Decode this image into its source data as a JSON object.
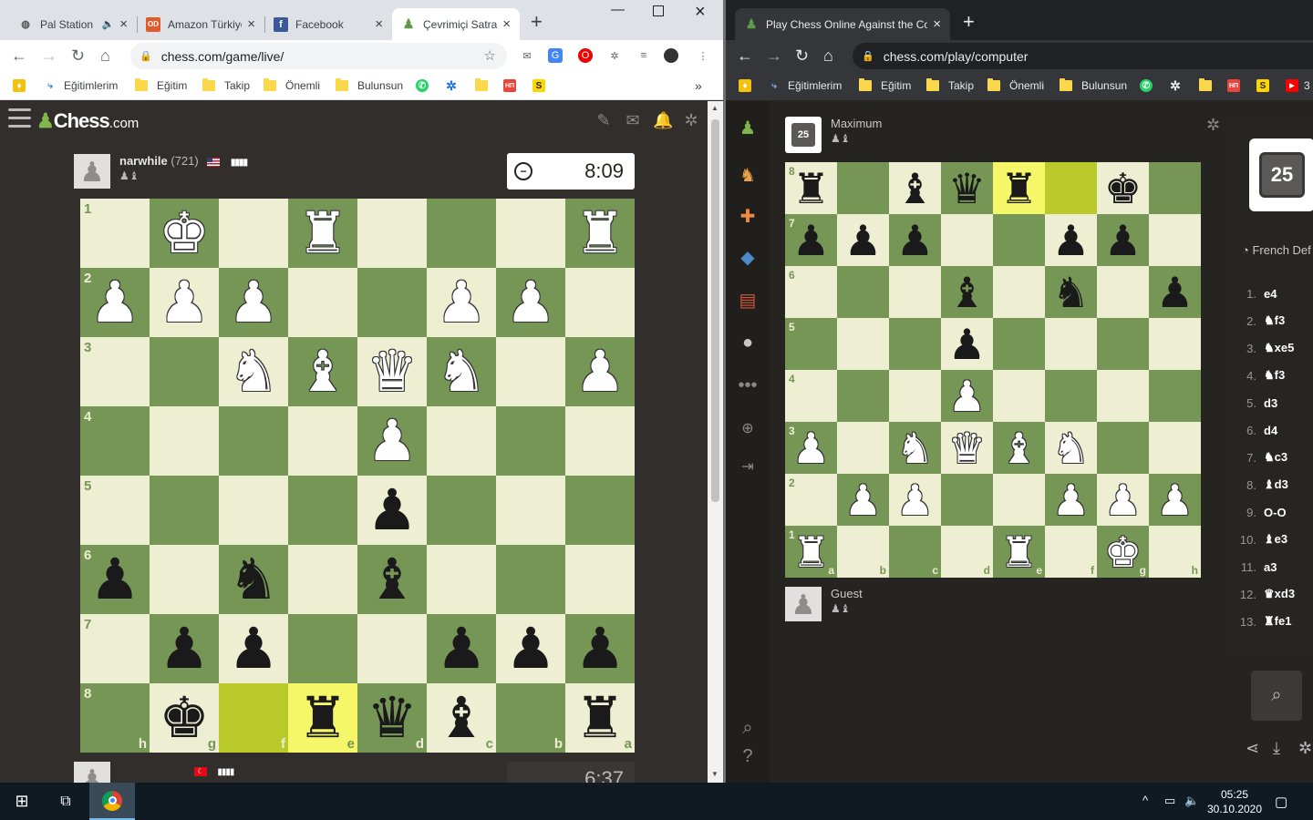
{
  "left_window": {
    "tabs": [
      {
        "title": "Pal Station",
        "icon": "globe-icon",
        "audio": true
      },
      {
        "title": "Amazon Türkiye",
        "icon": "amazon-icon"
      },
      {
        "title": "Facebook",
        "icon": "facebook-icon"
      },
      {
        "title": "Çevrimiçi Satranç",
        "icon": "chess-pawn-icon",
        "active": true
      }
    ],
    "url": "chess.com/game/live/",
    "bookmarks": [
      "Eğitimlerim",
      "Eğitim",
      "Takip",
      "Önemli",
      "Bulunsun"
    ],
    "bookmarks_overflow": "»"
  },
  "left_site": {
    "logo_text": "Chess",
    "logo_suffix": ".com",
    "top_player": {
      "name": "narwhile",
      "rating": "(721)",
      "flag": "US",
      "captured": "♟♝"
    },
    "top_clock": "8:09",
    "bottom_flag": "TR",
    "bottom_clock": "6:37",
    "board": {
      "ranks": [
        "1",
        "2",
        "3",
        "4",
        "5",
        "6",
        "7",
        "8"
      ],
      "files": [
        "h",
        "g",
        "f",
        "e",
        "d",
        "c",
        "b",
        "a"
      ],
      "rows": [
        [
          "",
          "wK",
          "",
          "wR",
          "",
          "",
          "",
          "wR"
        ],
        [
          "wP",
          "wP",
          "wP",
          "",
          "",
          "wP",
          "wP",
          ""
        ],
        [
          "",
          "",
          "wN",
          "wB",
          "wQ",
          "wN",
          "",
          "wP"
        ],
        [
          "",
          "",
          "",
          "",
          "wP",
          "",
          "",
          ""
        ],
        [
          "",
          "",
          "",
          "",
          "bP",
          "",
          "",
          ""
        ],
        [
          "bP",
          "",
          "bN",
          "",
          "bB",
          "",
          "",
          ""
        ],
        [
          "",
          "bP",
          "bP",
          "",
          "",
          "bP",
          "bP",
          "bP"
        ],
        [
          "",
          "bK",
          "",
          "bR",
          "bQ",
          "bB",
          "",
          "bR"
        ]
      ],
      "highlights": [
        [
          7,
          2
        ],
        [
          7,
          3
        ]
      ]
    }
  },
  "right_window": {
    "tabs": [
      {
        "title": "Play Chess Online Against the Co",
        "icon": "chess-pawn-icon",
        "active": true
      }
    ],
    "url": "chess.com/play/computer",
    "bookmarks": [
      "Eğitimlerim",
      "Eğitim",
      "Takip",
      "Önemli",
      "Bulunsun"
    ],
    "bookmarks_overflow": "3"
  },
  "right_site": {
    "opponent": {
      "name": "Maximum",
      "level": "25",
      "captured": "♟♝"
    },
    "player": {
      "name": "Guest",
      "captured": "♟♝"
    },
    "cpu_level": "25",
    "opening": "French Def",
    "moves": [
      {
        "n": "1.",
        "m": "e4"
      },
      {
        "n": "2.",
        "m": "♞f3"
      },
      {
        "n": "3.",
        "m": "♞xe5"
      },
      {
        "n": "4.",
        "m": "♞f3"
      },
      {
        "n": "5.",
        "m": "d3"
      },
      {
        "n": "6.",
        "m": "d4"
      },
      {
        "n": "7.",
        "m": "♞c3"
      },
      {
        "n": "8.",
        "m": "♝d3"
      },
      {
        "n": "9.",
        "m": "O-O"
      },
      {
        "n": "10.",
        "m": "♝e3"
      },
      {
        "n": "11.",
        "m": "a3"
      },
      {
        "n": "12.",
        "m": "♛xd3"
      },
      {
        "n": "13.",
        "m": "♜fe1"
      }
    ],
    "board": {
      "ranks": [
        "8",
        "7",
        "6",
        "5",
        "4",
        "3",
        "2",
        "1"
      ],
      "files": [
        "a",
        "b",
        "c",
        "d",
        "e",
        "f",
        "g",
        "h"
      ],
      "rows": [
        [
          "bR",
          "",
          "bB",
          "bQ",
          "bR",
          "",
          "bK",
          ""
        ],
        [
          "bP",
          "bP",
          "bP",
          "",
          "",
          "bP",
          "bP",
          ""
        ],
        [
          "",
          "",
          "",
          "bB",
          "",
          "bN",
          "",
          "bP"
        ],
        [
          "",
          "",
          "",
          "bP",
          "",
          "",
          "",
          ""
        ],
        [
          "",
          "",
          "",
          "wP",
          "",
          "",
          "",
          ""
        ],
        [
          "wP",
          "",
          "wN",
          "wQ",
          "wB",
          "wN",
          "",
          ""
        ],
        [
          "",
          "wP",
          "wP",
          "",
          "",
          "wP",
          "wP",
          "wP"
        ],
        [
          "wR",
          "",
          "",
          "",
          "wR",
          "",
          "wK",
          ""
        ]
      ],
      "highlights": [
        [
          0,
          4
        ],
        [
          0,
          5
        ]
      ]
    }
  },
  "taskbar": {
    "time": "05:25",
    "date": "30.10.2020"
  },
  "colors": {
    "light_square": "#eeeed2",
    "dark_square": "#769656",
    "highlight_light": "#f6f669",
    "highlight_dark": "#baca2b"
  }
}
